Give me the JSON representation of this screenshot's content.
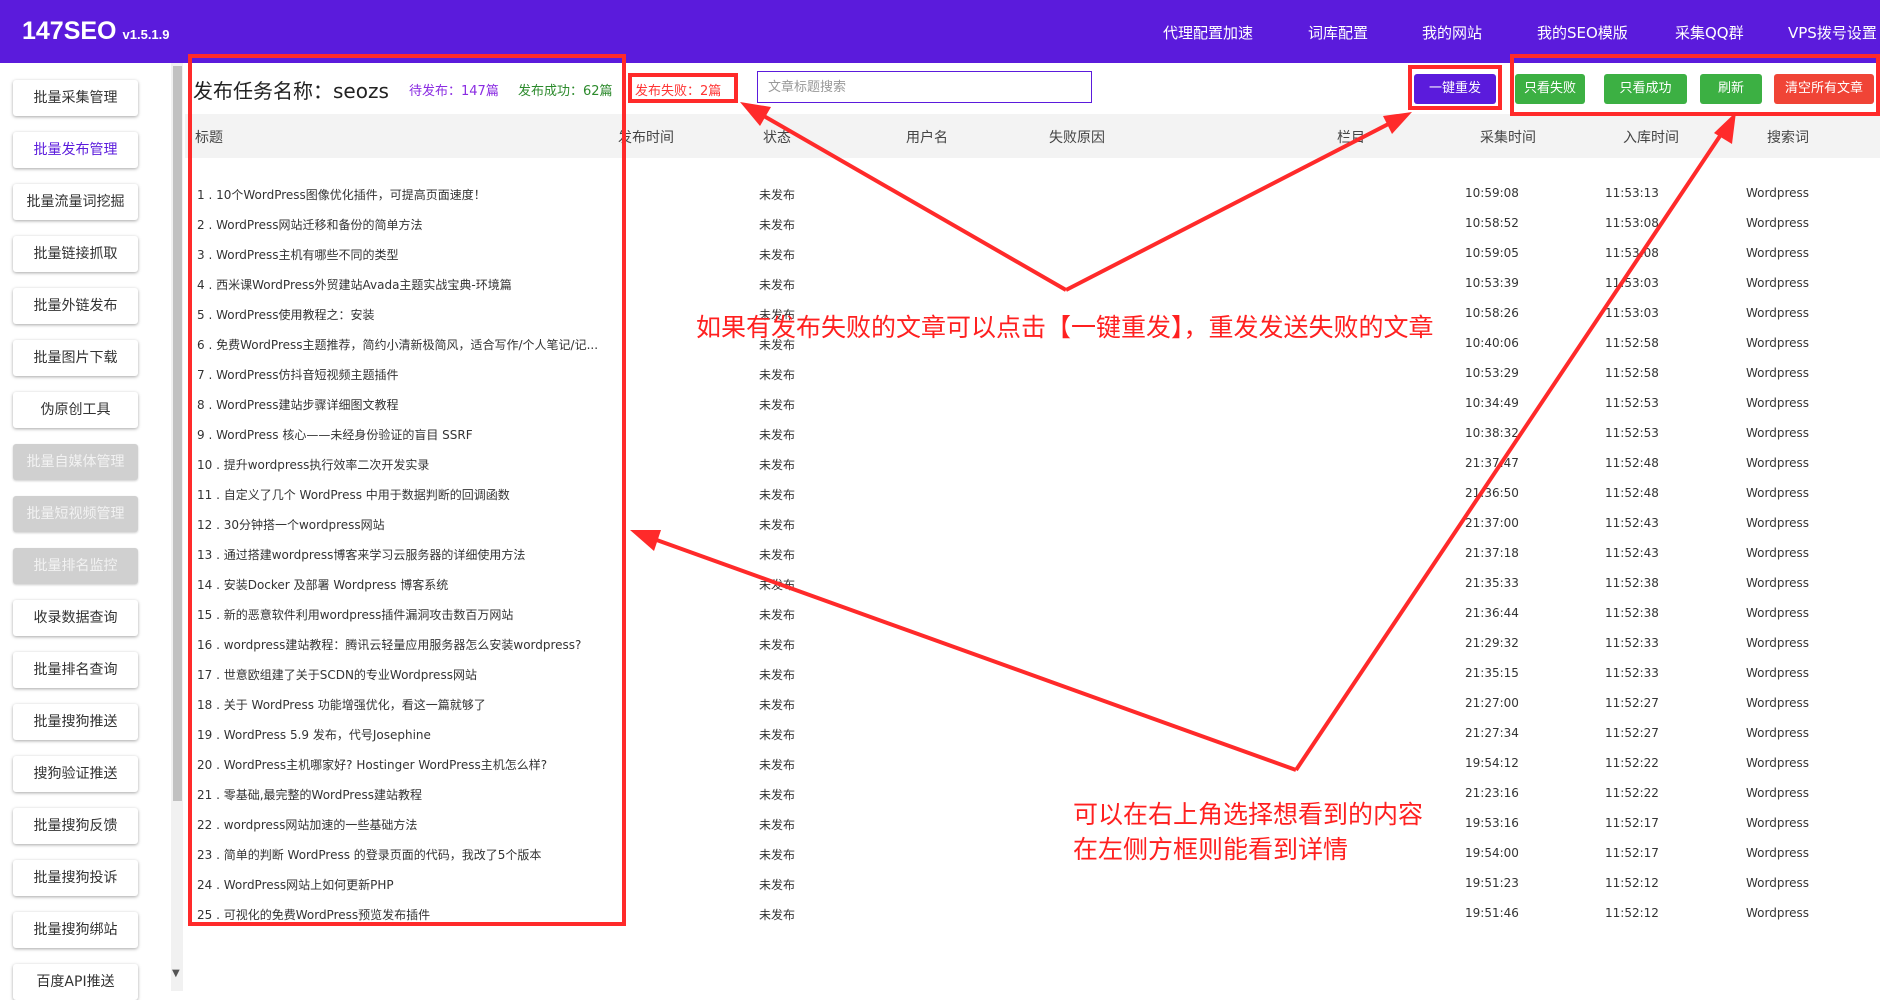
{
  "app": {
    "brand": "147SEO",
    "version": "v1.5.1.9"
  },
  "topnav": [
    "代理配置加速",
    "词库配置",
    "我的网站",
    "我的SEO模版",
    "采集QQ群",
    "VPS拨号设置"
  ],
  "sidebar": {
    "items": [
      {
        "label": "批量采集管理",
        "state": "normal"
      },
      {
        "label": "批量发布管理",
        "state": "active"
      },
      {
        "label": "批量流量词挖掘",
        "state": "normal"
      },
      {
        "label": "批量链接抓取",
        "state": "normal"
      },
      {
        "label": "批量外链发布",
        "state": "normal"
      },
      {
        "label": "批量图片下载",
        "state": "normal"
      },
      {
        "label": "伪原创工具",
        "state": "normal"
      },
      {
        "label": "批量自媒体管理",
        "state": "disabled"
      },
      {
        "label": "批量短视频管理",
        "state": "disabled"
      },
      {
        "label": "批量排名监控",
        "state": "disabled"
      },
      {
        "label": "收录数据查询",
        "state": "normal"
      },
      {
        "label": "批量排名查询",
        "state": "normal"
      },
      {
        "label": "批量搜狗推送",
        "state": "normal"
      },
      {
        "label": "搜狗验证推送",
        "state": "normal"
      },
      {
        "label": "批量搜狗反馈",
        "state": "normal"
      },
      {
        "label": "批量搜狗投诉",
        "state": "normal"
      },
      {
        "label": "批量搜狗绑站",
        "state": "normal"
      },
      {
        "label": "百度API推送",
        "state": "normal"
      }
    ]
  },
  "task": {
    "title": "发布任务名称：seozs",
    "pending": "待发布：147篇",
    "success": "发布成功：62篇",
    "failed": "发布失败：2篇"
  },
  "search": {
    "placeholder": "文章标题搜索",
    "value": ""
  },
  "actions": {
    "republish": "一键重发",
    "only_failed": "只看失败",
    "only_success": "只看成功",
    "refresh": "刷新",
    "clear_all": "清空所有文章"
  },
  "table": {
    "columns": [
      "标题",
      "发布时间",
      "状态",
      "用户名",
      "失败原因",
      "栏目",
      "采集时间",
      "入库时间",
      "搜索词"
    ],
    "rows": [
      {
        "title": "1 . 10个WordPress图像优化插件，可提高页面速度！",
        "status": "未发布",
        "collect": "10:59:08",
        "instock": "11:53:13",
        "kw": "Wordpress"
      },
      {
        "title": "2 . WordPress网站迁移和备份的简单方法",
        "status": "未发布",
        "collect": "10:58:52",
        "instock": "11:53:08",
        "kw": "Wordpress"
      },
      {
        "title": "3 . WordPress主机有哪些不同的类型",
        "status": "未发布",
        "collect": "10:59:05",
        "instock": "11:53:08",
        "kw": "Wordpress"
      },
      {
        "title": "4 . 西米课WordPress外贸建站Avada主题实战宝典-环境篇",
        "status": "未发布",
        "collect": "10:53:39",
        "instock": "11:53:03",
        "kw": "Wordpress"
      },
      {
        "title": "5 . WordPress使用教程之：安装",
        "status": "未发布",
        "collect": "10:58:26",
        "instock": "11:53:03",
        "kw": "Wordpress"
      },
      {
        "title": "6 . 免费WordPress主题推荐，简约小清新极简风，适合写作/个人笔记/记...",
        "status": "未发布",
        "collect": "10:40:06",
        "instock": "11:52:58",
        "kw": "Wordpress"
      },
      {
        "title": "7 . WordPress仿抖音短视频主题插件",
        "status": "未发布",
        "collect": "10:53:29",
        "instock": "11:52:58",
        "kw": "Wordpress"
      },
      {
        "title": "8 . WordPress建站步骤详细图文教程",
        "status": "未发布",
        "collect": "10:34:49",
        "instock": "11:52:53",
        "kw": "Wordpress"
      },
      {
        "title": "9 . WordPress 核心——未经身份验证的盲目 SSRF",
        "status": "未发布",
        "collect": "10:38:32",
        "instock": "11:52:53",
        "kw": "Wordpress"
      },
      {
        "title": "10 . 提升wordpress执行效率二次开发实录",
        "status": "未发布",
        "collect": "21:37:47",
        "instock": "11:52:48",
        "kw": "Wordpress"
      },
      {
        "title": "11 . 自定义了几个 WordPress 中用于数据判断的回调函数",
        "status": "未发布",
        "collect": "21:36:50",
        "instock": "11:52:48",
        "kw": "Wordpress"
      },
      {
        "title": "12 . 30分钟搭一个wordpress网站",
        "status": "未发布",
        "collect": "21:37:00",
        "instock": "11:52:43",
        "kw": "Wordpress"
      },
      {
        "title": "13 . 通过搭建wordpress博客来学习云服务器的详细使用方法",
        "status": "未发布",
        "collect": "21:37:18",
        "instock": "11:52:43",
        "kw": "Wordpress"
      },
      {
        "title": "14 . 安装Docker 及部署 Wordpress 博客系统",
        "status": "未发布",
        "collect": "21:35:33",
        "instock": "11:52:38",
        "kw": "Wordpress"
      },
      {
        "title": "15 . 新的恶意软件利用wordpress插件漏洞攻击数百万网站",
        "status": "未发布",
        "collect": "21:36:44",
        "instock": "11:52:38",
        "kw": "Wordpress"
      },
      {
        "title": "16 . wordpress建站教程：腾讯云轻量应用服务器怎么安装wordpress?",
        "status": "未发布",
        "collect": "21:29:32",
        "instock": "11:52:33",
        "kw": "Wordpress"
      },
      {
        "title": "17 . 世意欧组建了关于SCDN的专业Wordpress网站",
        "status": "未发布",
        "collect": "21:35:15",
        "instock": "11:52:33",
        "kw": "Wordpress"
      },
      {
        "title": "18 . 关于 WordPress 功能增强优化，看这一篇就够了",
        "status": "未发布",
        "collect": "21:27:00",
        "instock": "11:52:27",
        "kw": "Wordpress"
      },
      {
        "title": "19 . WordPress 5.9 发布，代号Josephine",
        "status": "未发布",
        "collect": "21:27:34",
        "instock": "11:52:27",
        "kw": "Wordpress"
      },
      {
        "title": "20 . WordPress主机哪家好? Hostinger WordPress主机怎么样?",
        "status": "未发布",
        "collect": "19:54:12",
        "instock": "11:52:22",
        "kw": "Wordpress"
      },
      {
        "title": "21 . 零基础,最完整的WordPress建站教程",
        "status": "未发布",
        "collect": "21:23:16",
        "instock": "11:52:22",
        "kw": "Wordpress"
      },
      {
        "title": "22 . wordpress网站加速的一些基础方法",
        "status": "未发布",
        "collect": "19:53:16",
        "instock": "11:52:17",
        "kw": "Wordpress"
      },
      {
        "title": "23 . 简单的判断 WordPress 的登录页面的代码，我改了5个版本",
        "status": "未发布",
        "collect": "19:54:00",
        "instock": "11:52:17",
        "kw": "Wordpress"
      },
      {
        "title": "24 . WordPress网站上如何更新PHP",
        "status": "未发布",
        "collect": "19:51:23",
        "instock": "11:52:12",
        "kw": "Wordpress"
      },
      {
        "title": "25 . 可视化的免费WordPress预览发布插件",
        "status": "未发布",
        "collect": "19:51:46",
        "instock": "11:52:12",
        "kw": "Wordpress"
      }
    ]
  },
  "annotations": {
    "note1": "如果有发布失败的文章可以点击【一键重发】，重发发送失败的文章",
    "note2_line1": "可以在右上角选择想看到的内容",
    "note2_line2": "在左侧方框则能看到详情"
  },
  "colors": {
    "brand": "#5b1bdc",
    "green": "#3cb043",
    "danger": "#f04436",
    "annotation": "#ff2a2a",
    "pending": "#8a2be2",
    "success": "#2c8a2c",
    "failed": "#ff3333"
  }
}
